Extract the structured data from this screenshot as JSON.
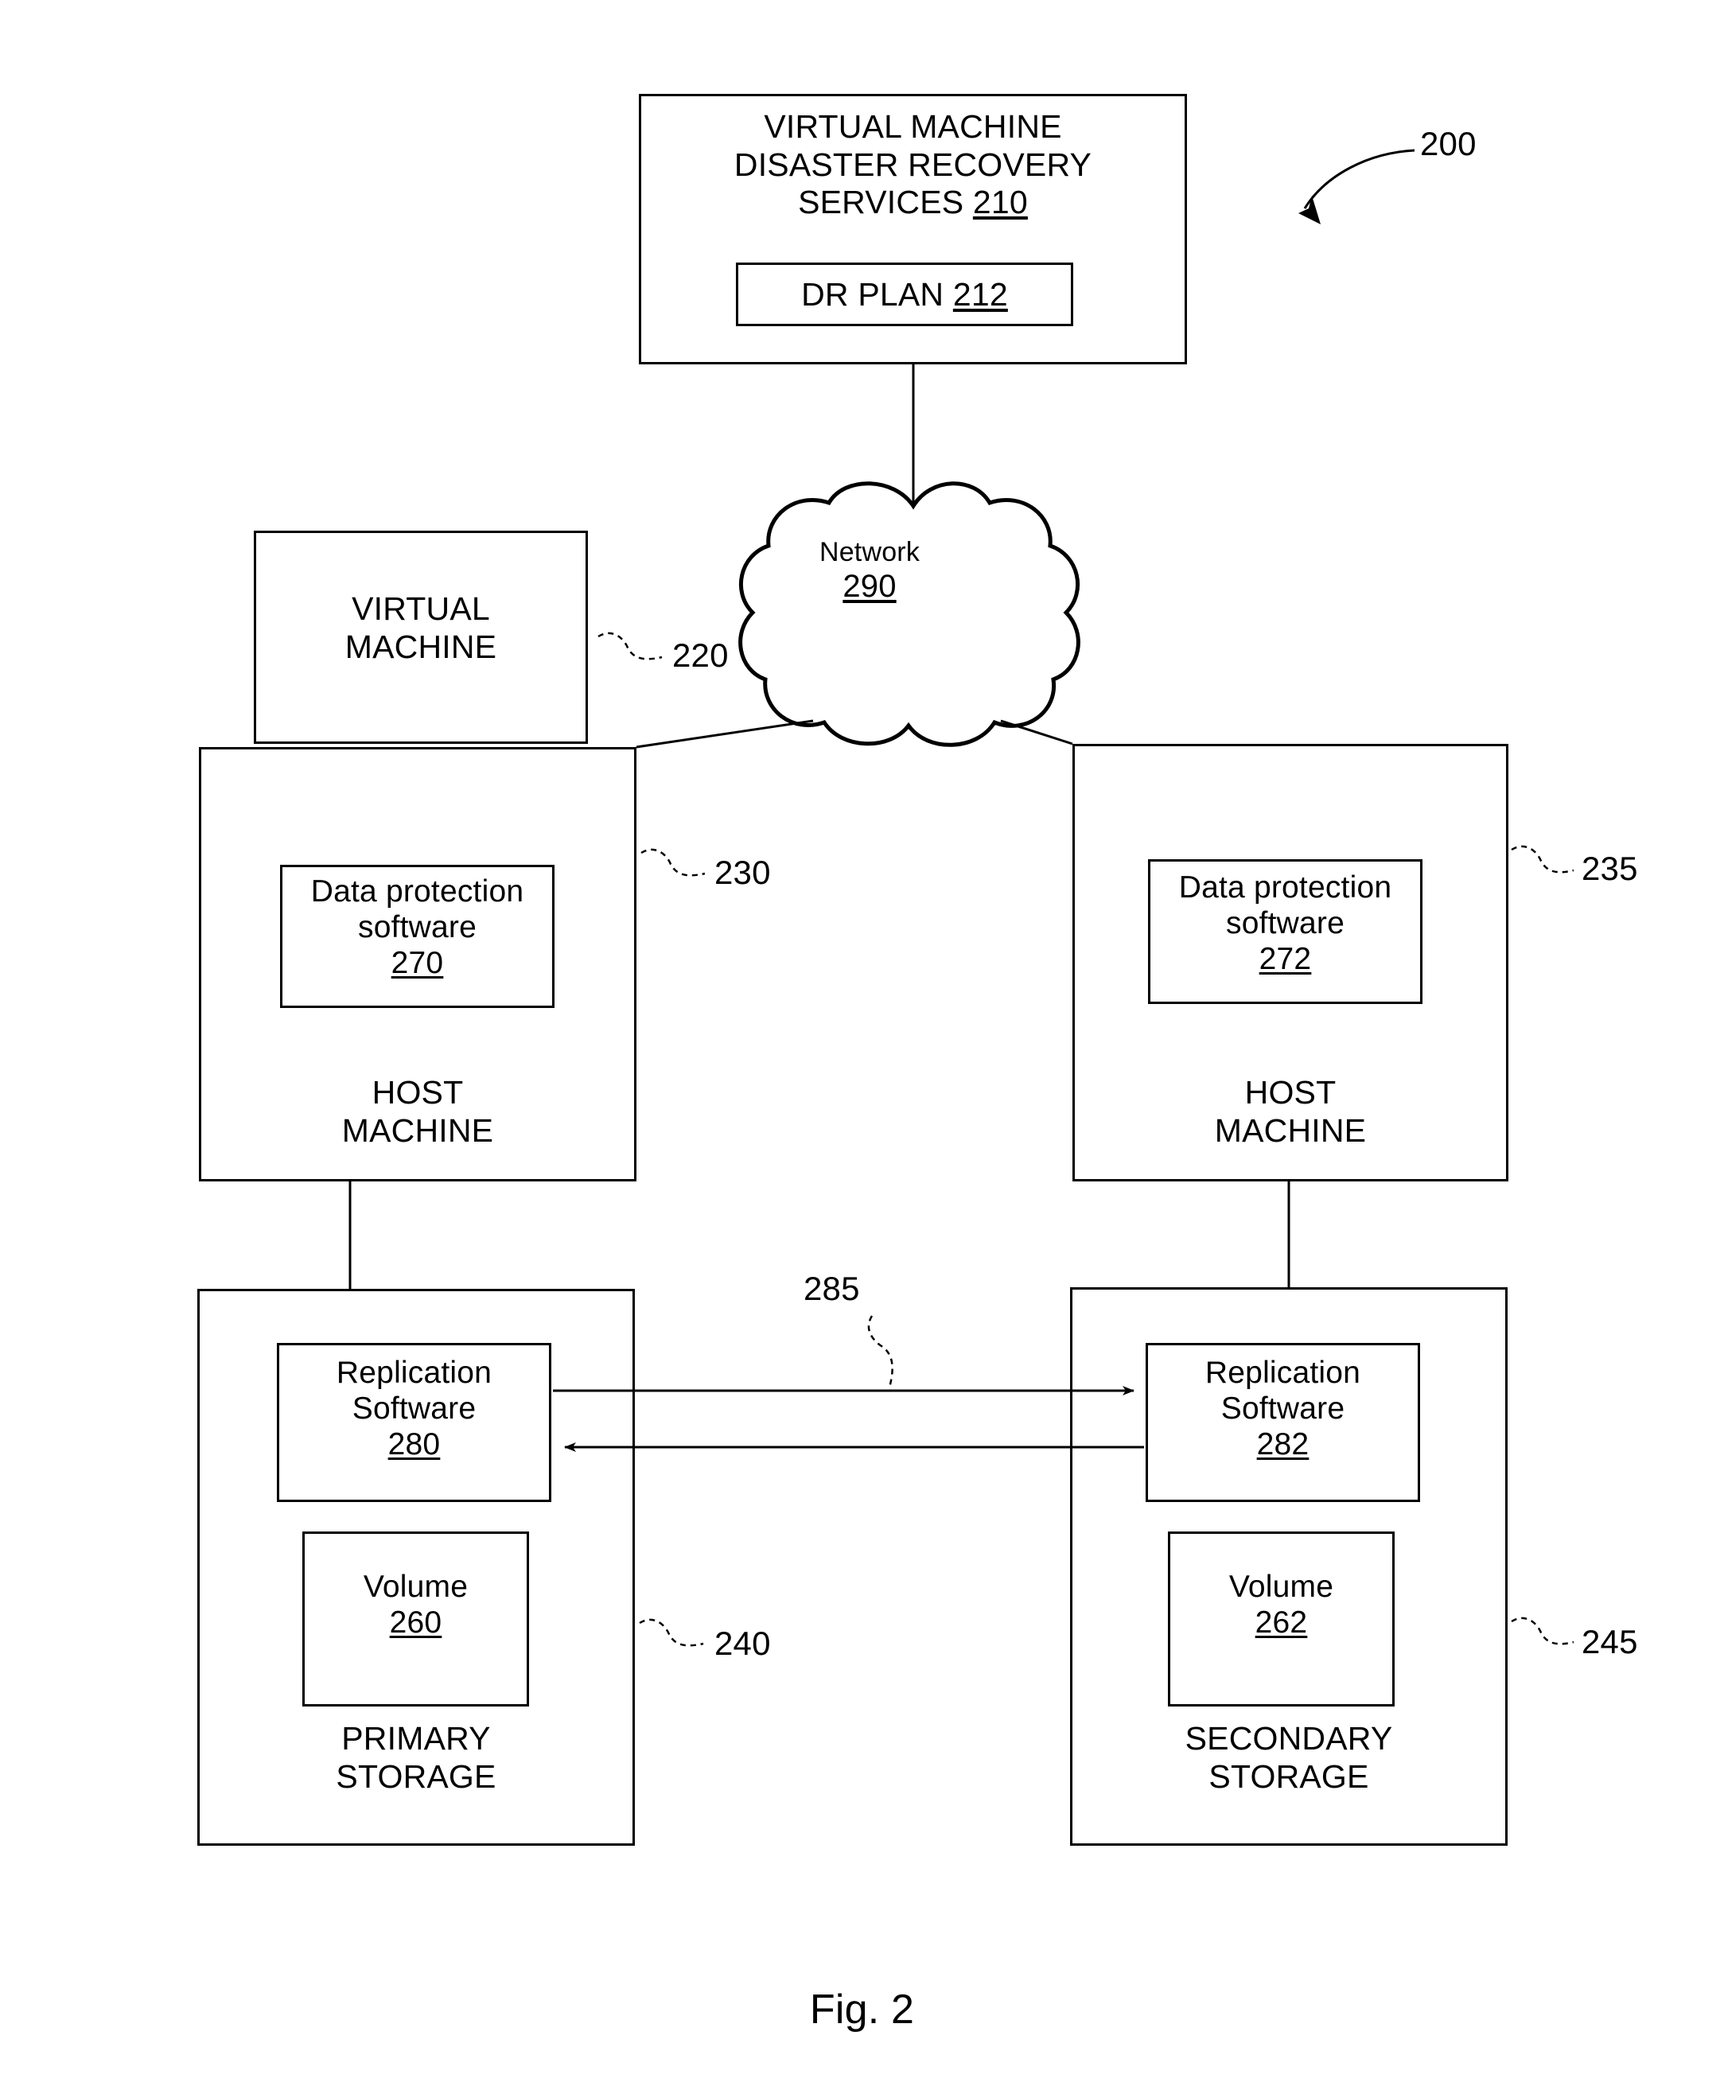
{
  "figure": {
    "caption": "Fig. 2",
    "overall_ref": "200"
  },
  "nodes": {
    "dr_services": {
      "title": "VIRTUAL MACHINE\nDISASTER RECOVERY\nSERVICES ",
      "ref": "210",
      "child": {
        "title": "DR PLAN ",
        "ref": "212"
      }
    },
    "network": {
      "title": "Network",
      "ref": "290"
    },
    "virtual_machine": {
      "title": "VIRTUAL\nMACHINE",
      "ref": "220"
    },
    "host_left": {
      "title": "HOST\nMACHINE",
      "ref": "230",
      "child": {
        "title": "Data protection\nsoftware\n",
        "ref": "270"
      }
    },
    "host_right": {
      "title": "HOST\nMACHINE",
      "ref": "235",
      "child": {
        "title": "Data protection\nsoftware\n",
        "ref": "272"
      }
    },
    "storage_primary": {
      "title": "PRIMARY\nSTORAGE",
      "ref": "240",
      "replication": {
        "title": "Replication\nSoftware\n",
        "ref": "280"
      },
      "volume": {
        "title": "Volume\n",
        "ref": "260"
      }
    },
    "storage_secondary": {
      "title": "SECONDARY\nSTORAGE",
      "ref": "245",
      "replication": {
        "title": "Replication\nSoftware\n",
        "ref": "282"
      },
      "volume": {
        "title": "Volume\n",
        "ref": "262"
      }
    },
    "replication_link": {
      "ref": "285"
    }
  },
  "style": {
    "line_color": "#000000",
    "background": "#ffffff"
  }
}
